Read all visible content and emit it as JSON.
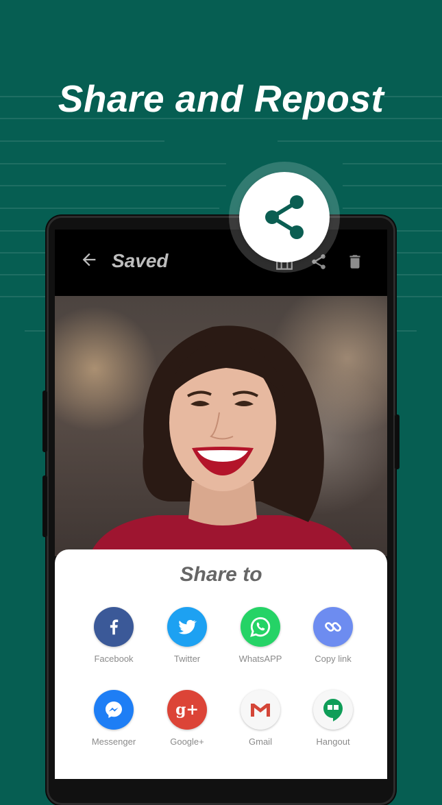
{
  "headline": "Share and Repost",
  "toolbar": {
    "title": "Saved",
    "icons": [
      "back-arrow-icon",
      "gallery-icon",
      "share-icon",
      "trash-icon"
    ]
  },
  "share_sheet": {
    "title": "Share to",
    "apps": [
      {
        "label": "Facebook",
        "icon": "facebook-icon",
        "color": "#3b5998"
      },
      {
        "label": "Twitter",
        "icon": "twitter-icon",
        "color": "#1da1f2"
      },
      {
        "label": "WhatsAPP",
        "icon": "whatsapp-icon",
        "color": "#25d366"
      },
      {
        "label": "Copy link",
        "icon": "link-icon",
        "color": "#6d8cf0"
      },
      {
        "label": "Messenger",
        "icon": "messenger-icon",
        "color": "#1e7ef5"
      },
      {
        "label": "Google+",
        "icon": "google-plus-icon",
        "color": "#dc4437"
      },
      {
        "label": "Gmail",
        "icon": "gmail-icon",
        "color": "#ffffff"
      },
      {
        "label": "Hangout",
        "icon": "hangout-icon",
        "color": "#ffffff"
      }
    ]
  },
  "colors": {
    "background": "#065e52",
    "share_icon": "#0b5e52",
    "sheet": "#ffffff"
  }
}
